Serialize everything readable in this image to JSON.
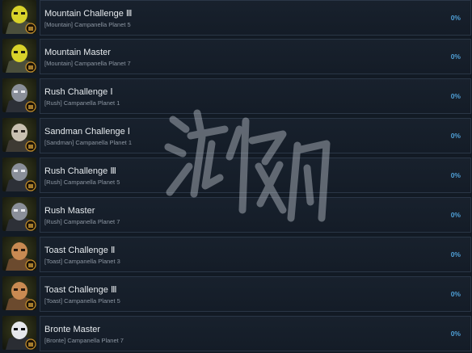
{
  "achievements": [
    {
      "name": "Mountain Challenge Ⅲ",
      "desc": "[Mountain] Campanella Planet 5",
      "percent": "0%",
      "icon": "mountain-yellow-icon",
      "theme": "yellow"
    },
    {
      "name": "Mountain Master",
      "desc": "[Mountain] Campanella Planet 7",
      "percent": "0%",
      "icon": "mountain-yellow-icon",
      "theme": "yellow"
    },
    {
      "name": "Rush Challenge Ⅰ",
      "desc": "[Rush] Campanella Planet 1",
      "percent": "0%",
      "icon": "rush-dark-icon",
      "theme": "dark"
    },
    {
      "name": "Sandman Challenge Ⅰ",
      "desc": "[Sandman] Campanella Planet 1",
      "percent": "0%",
      "icon": "sandman-icon",
      "theme": "tan"
    },
    {
      "name": "Rush Challenge Ⅲ",
      "desc": "[Rush] Campanella Planet 5",
      "percent": "0%",
      "icon": "rush-dark-icon",
      "theme": "dark"
    },
    {
      "name": "Rush Master",
      "desc": "[Rush] Campanella Planet 7",
      "percent": "0%",
      "icon": "rush-dark-icon",
      "theme": "dark"
    },
    {
      "name": "Toast Challenge Ⅱ",
      "desc": "[Toast] Campanella Planet 3",
      "percent": "0%",
      "icon": "toast-icon",
      "theme": "orange"
    },
    {
      "name": "Toast Challenge Ⅲ",
      "desc": "[Toast] Campanella Planet 5",
      "percent": "0%",
      "icon": "toast-icon",
      "theme": "orange"
    },
    {
      "name": "Bronte Master",
      "desc": "[Bronte] Campanella Planet 7",
      "percent": "0%",
      "icon": "bronte-icon",
      "theme": "bronte"
    }
  ],
  "colors": {
    "background": "#121a24",
    "panel_border": "#2a3646",
    "percent": "#4f9fd6"
  },
  "watermark_icon": "watermark-logo"
}
